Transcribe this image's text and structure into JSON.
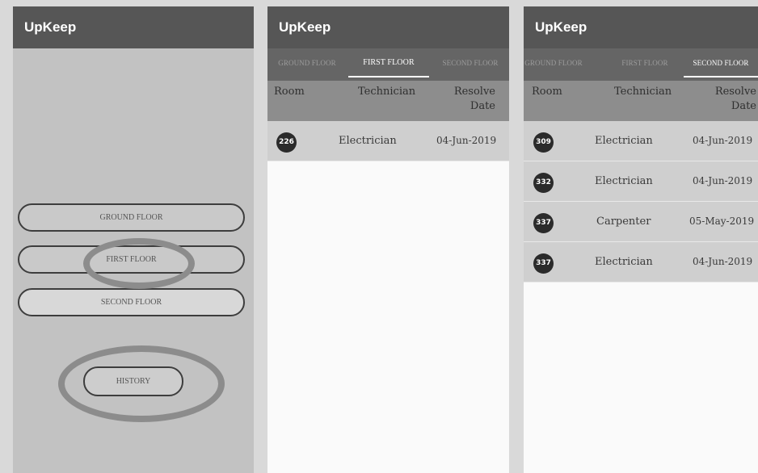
{
  "app_title": "UpKeep",
  "home": {
    "buttons": [
      {
        "label": "GROUND FLOOR"
      },
      {
        "label": "FIRST FLOOR"
      },
      {
        "label": "SECOND FLOOR"
      }
    ],
    "history_label": "HISTORY"
  },
  "floor_tabs": [
    "GROUND FLOOR",
    "FIRST FLOOR",
    "SECOND FLOOR"
  ],
  "table_headers": {
    "room": "Room",
    "technician": "Technician",
    "resolve_line1": "Resolve",
    "resolve_line2": "Date"
  },
  "first_floor": {
    "active_tab": "FIRST FLOOR",
    "rows": [
      {
        "room": "226",
        "technician": "Electrician",
        "date": "04-Jun-2019"
      }
    ]
  },
  "second_floor": {
    "active_tab": "SECOND FLOOR",
    "rows": [
      {
        "room": "309",
        "technician": "Electrician",
        "date": "04-Jun-2019"
      },
      {
        "room": "332",
        "technician": "Electrician",
        "date": "04-Jun-2019"
      },
      {
        "room": "337",
        "technician": "Carpenter",
        "date": "05-May-2019"
      },
      {
        "room": "337",
        "technician": "Electrician",
        "date": "04-Jun-2019"
      }
    ]
  },
  "colors": {
    "appbar": "#565656",
    "tabbar": "#656565",
    "header": "#8d8d8d",
    "row": "#cfcfcf",
    "badge": "#2b2b2b",
    "highlight_ring": "#8c8c8c"
  }
}
